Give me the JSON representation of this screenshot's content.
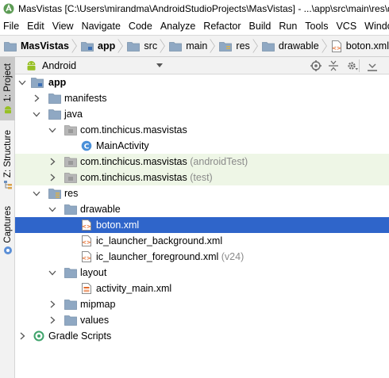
{
  "window": {
    "title": "MasVistas [C:\\Users\\mirandma\\AndroidStudioProjects\\MasVistas] - ...\\app\\src\\main\\res\\drawable\\boton.xml"
  },
  "menu": [
    "File",
    "Edit",
    "View",
    "Navigate",
    "Code",
    "Analyze",
    "Refactor",
    "Build",
    "Run",
    "Tools",
    "VCS",
    "Window"
  ],
  "breadcrumb": [
    "MasVistas",
    "app",
    "src",
    "main",
    "res",
    "drawable",
    "boton.xml"
  ],
  "side_tabs": [
    "1: Project",
    "Z: Structure",
    "Captures"
  ],
  "project_view": {
    "mode": "Android"
  },
  "tree": [
    {
      "label": "app",
      "suffix": "",
      "icon": "module-icon",
      "arrow": "expanded",
      "bold": true
    },
    {
      "label": "manifests",
      "suffix": "",
      "icon": "folder-icon",
      "arrow": "collapsed"
    },
    {
      "label": "java",
      "suffix": "",
      "icon": "folder-icon",
      "arrow": "expanded"
    },
    {
      "label": "com.tinchicus.masvistas",
      "suffix": "",
      "icon": "package-icon",
      "arrow": "expanded"
    },
    {
      "label": "MainActivity",
      "suffix": "",
      "icon": "class-icon",
      "arrow": "none"
    },
    {
      "label": "com.tinchicus.masvistas",
      "suffix": "(androidTest)",
      "icon": "package-icon",
      "arrow": "collapsed",
      "test": true
    },
    {
      "label": "com.tinchicus.masvistas",
      "suffix": "(test)",
      "icon": "package-icon",
      "arrow": "collapsed",
      "test": true
    },
    {
      "label": "res",
      "suffix": "",
      "icon": "res-folder-icon",
      "arrow": "expanded"
    },
    {
      "label": "drawable",
      "suffix": "",
      "icon": "folder-icon",
      "arrow": "expanded"
    },
    {
      "label": "boton.xml",
      "suffix": "",
      "icon": "xml-file-icon",
      "arrow": "none",
      "selected": true
    },
    {
      "label": "ic_launcher_background.xml",
      "suffix": "",
      "icon": "xml-file-icon",
      "arrow": "none"
    },
    {
      "label": "ic_launcher_foreground.xml",
      "suffix": "(v24)",
      "icon": "xml-file-icon",
      "arrow": "none"
    },
    {
      "label": "layout",
      "suffix": "",
      "icon": "folder-icon",
      "arrow": "expanded"
    },
    {
      "label": "activity_main.xml",
      "suffix": "",
      "icon": "layout-file-icon",
      "arrow": "none"
    },
    {
      "label": "mipmap",
      "suffix": "",
      "icon": "folder-icon",
      "arrow": "collapsed"
    },
    {
      "label": "values",
      "suffix": "",
      "icon": "folder-icon",
      "arrow": "collapsed"
    },
    {
      "label": "Gradle Scripts",
      "suffix": "",
      "icon": "gradle-icon",
      "arrow": "collapsed"
    }
  ],
  "colors": {
    "selection": "#2f65ca",
    "test_row": "#eef6e6",
    "folder": "#8fa8c3",
    "android_green": "#97c024",
    "xml_orange": "#e46a2a"
  }
}
